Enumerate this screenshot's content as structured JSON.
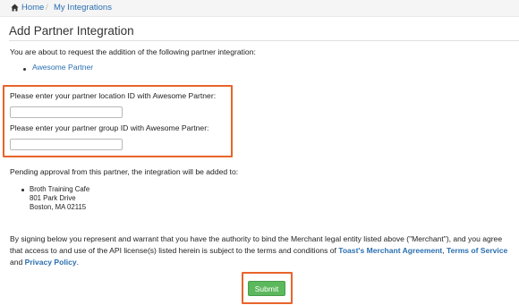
{
  "breadcrumb": {
    "home": "Home",
    "separator": "/",
    "current": "My Integrations"
  },
  "page": {
    "title": "Add Partner Integration",
    "intro": "You are about to request the addition of the following partner integration:",
    "partner_name": "Awesome Partner"
  },
  "form": {
    "location_label": "Please enter your partner location ID with Awesome Partner:",
    "location_value": "",
    "group_label": "Please enter your partner group ID with Awesome Partner:",
    "group_value": ""
  },
  "approval": {
    "text": "Pending approval from this partner, the integration will be added to:",
    "address_lines": [
      "Broth Training Cafe",
      "801 Park Drive",
      "Boston, MA 02115"
    ]
  },
  "legal": {
    "text_1": "By signing below you represent and warrant that you have the authority to bind the Merchant legal entity listed above (\"Merchant\"), and you agree that access to and use of the API license(s) listed herein is subject to the terms and conditions of ",
    "link_merchant_agreement": "Toast's Merchant Agreement",
    "sep_1": ", ",
    "link_terms": "Terms of Service",
    "sep_2": " and ",
    "link_privacy": "Privacy Policy",
    "end": "."
  },
  "submit_label": "Submit",
  "colors": {
    "link": "#2a6fb0",
    "highlight": "#e8642b",
    "submit": "#5cb85c"
  },
  "icons": {
    "home": "home-icon"
  }
}
